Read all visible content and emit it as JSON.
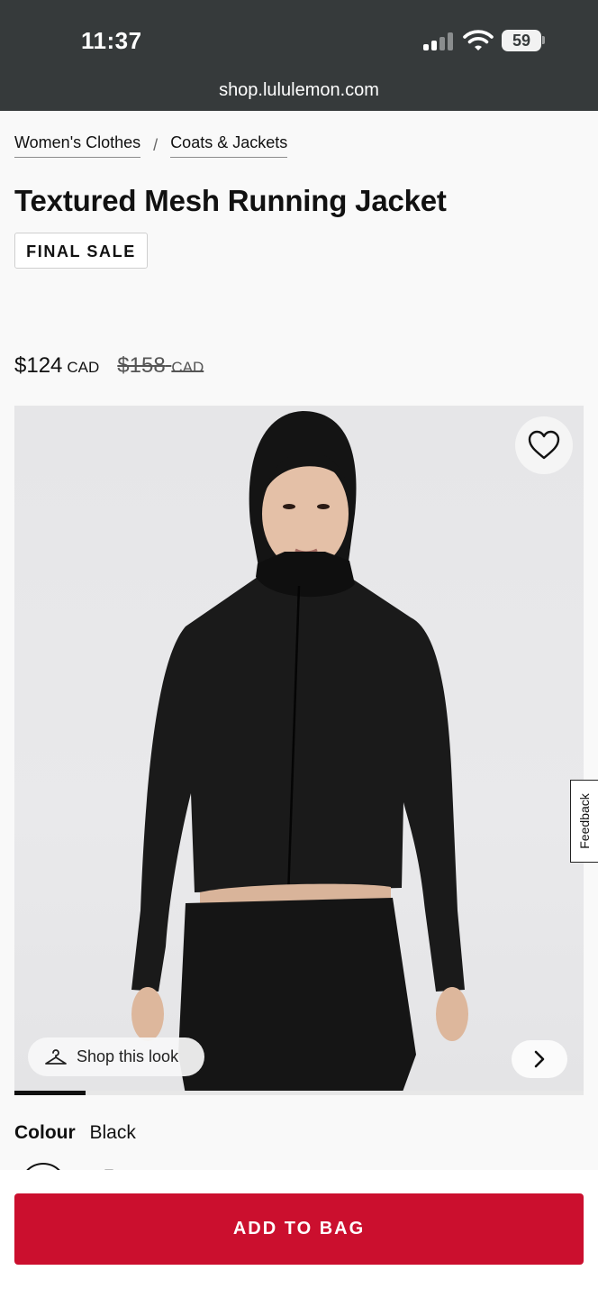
{
  "status_bar": {
    "time": "11:37",
    "battery": "59"
  },
  "browser": {
    "url": "shop.lululemon.com"
  },
  "breadcrumb": {
    "items": [
      "Women's Clothes",
      "Coats & Jackets"
    ],
    "separator": "/"
  },
  "product": {
    "title": "Textured Mesh Running Jacket",
    "badge": "FINAL SALE",
    "price": {
      "current": "$124",
      "current_currency": "CAD",
      "original": "$158",
      "original_currency": "CAD"
    },
    "image": {
      "shop_look_label": "Shop this look",
      "gallery_progress": 0.125
    },
    "colour": {
      "label": "Colour",
      "value": "Black"
    }
  },
  "feedback": {
    "label": "Feedback"
  },
  "actions": {
    "add_to_bag": "ADD TO BAG"
  },
  "colors": {
    "brand_red": "#cb0f2e",
    "status_bar": "#363a3b"
  },
  "icons": {
    "wishlist": "heart-icon",
    "shop_look": "hanger-icon",
    "next": "chevron-right-icon"
  }
}
